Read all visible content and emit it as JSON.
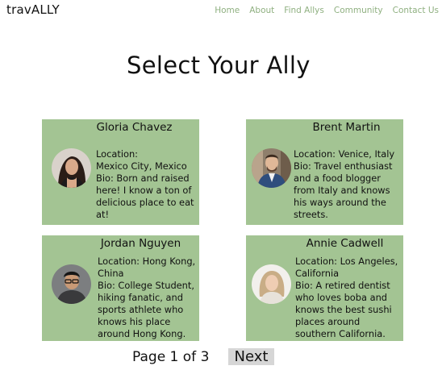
{
  "brand": {
    "logo": "travALLY"
  },
  "nav": [
    "Home",
    "About",
    "Find Allys",
    "Community",
    "Contact Us"
  ],
  "page": {
    "title": "Select Your Ally"
  },
  "allies": [
    {
      "name": "Gloria Chavez",
      "location_label": "Location:",
      "location": "Mexico City, Mexico",
      "bio": "Bio: Born and raised here! I know a ton of delicious place to eat at!"
    },
    {
      "name": "Brent Martin",
      "location_label": "Location: Venice, Italy",
      "location": "",
      "bio": "Bio: Travel enthusiast and a food blogger from Italy and knows his ways around the streets."
    },
    {
      "name": "Jordan Nguyen",
      "location_label": "Location: Hong Kong, China",
      "location": "",
      "bio": "Bio: College Student, hiking fanatic, and sports athlete who knows his place around Hong Kong."
    },
    {
      "name": "Annie Cadwell",
      "location_label": "Location: Los Angeles, California",
      "location": "",
      "bio": "Bio: A retired dentist who loves boba and knows the best sushi places around southern California."
    }
  ],
  "pagination": {
    "status": "Page 1 of 3",
    "next_label": "Next"
  },
  "colors": {
    "card_bg": "#a3c493",
    "nav_text": "#8fb080",
    "button_bg": "#d6d6d6"
  }
}
